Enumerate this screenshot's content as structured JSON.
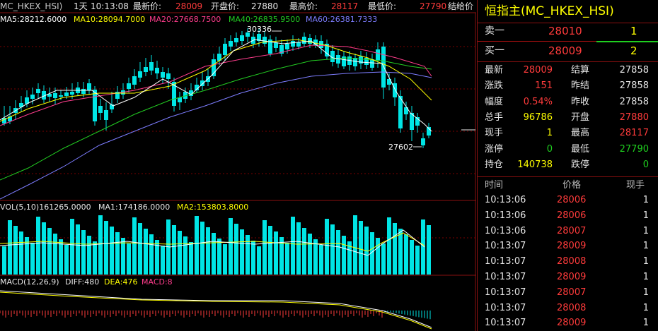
{
  "top_bar": {
    "symbol": "MC_HKEX_HSI)",
    "period": "1天",
    "time": "10:13:08",
    "latest_label": "最新价:",
    "latest_value": "28009",
    "open_label": "开盘价:",
    "open_value": "27880",
    "high_label": "最高价:",
    "high_value": "28117",
    "low_label": "最低价:",
    "low_value": "27790",
    "settle_label": "结给价"
  },
  "ma_legend": {
    "ma5": "MA5:28212.6000",
    "ma10": "MA10:28094.7000",
    "ma20": "MA20:27668.7500",
    "ma40": "MA40:26835.9500",
    "ma60": "MA60:26381.7333"
  },
  "annotations": {
    "high_marker": "30336",
    "low_marker": "27602"
  },
  "vol_legend": {
    "vol": "VOL(5,10)161265.0000",
    "ma1": "MA1:174186.0000",
    "ma2": "MA2:153803.8000"
  },
  "macd_legend": {
    "name": "MACD(12,26,9)",
    "diff": "DIFF:480",
    "dea": "DEA:476",
    "macd": "MACD:8"
  },
  "colors": {
    "up": "#ff3b3b",
    "down": "#00e5e5",
    "ma5": "#ffffff",
    "ma10": "#ffff00",
    "ma20": "#ff3d8c",
    "ma40": "#22cc22",
    "ma60": "#7d7dff",
    "panel_border": "#8a1010"
  },
  "panel": {
    "title": "恒指主(MC_HKEX_HSI)",
    "ask_label": "卖一",
    "ask_price": "28010",
    "ask_qty": "1",
    "bid_label": "买一",
    "bid_price": "28009",
    "bid_qty": "2",
    "stats": [
      {
        "l1": "最新",
        "v1": "28009",
        "c1": "red",
        "l2": "结算",
        "v2": "27858",
        "c2": "white"
      },
      {
        "l1": "涨跌",
        "v1": "151",
        "c1": "red",
        "l2": "昨结",
        "v2": "27858",
        "c2": "white"
      },
      {
        "l1": "幅度",
        "v1": "0.54%",
        "c1": "red",
        "l2": "昨收",
        "v2": "27858",
        "c2": "white"
      },
      {
        "l1": "总手",
        "v1": "96786",
        "c1": "yellow",
        "l2": "开盘",
        "v2": "27880",
        "c2": "red"
      },
      {
        "l1": "现手",
        "v1": "1",
        "c1": "yellow",
        "l2": "最高",
        "v2": "28117",
        "c2": "red"
      },
      {
        "l1": "涨停",
        "v1": "0",
        "c1": "green",
        "l2": "最低",
        "v2": "27790",
        "c2": "green"
      },
      {
        "l1": "持仓",
        "v1": "140738",
        "c1": "yellow",
        "l2": "跌停",
        "v2": "0",
        "c2": "green"
      }
    ],
    "ticks_header": {
      "time": "时间",
      "price": "价格",
      "qty": "现手"
    },
    "ticks": [
      {
        "time": "10:13:06",
        "price": "28006",
        "qty": "1"
      },
      {
        "time": "10:13:06",
        "price": "28006",
        "qty": "1"
      },
      {
        "time": "10:13:06",
        "price": "28007",
        "qty": "1"
      },
      {
        "time": "10:13:07",
        "price": "28009",
        "qty": "1"
      },
      {
        "time": "10:13:07",
        "price": "28008",
        "qty": "1"
      },
      {
        "time": "10:13:07",
        "price": "28009",
        "qty": "1"
      },
      {
        "time": "10:13:07",
        "price": "28007",
        "qty": "1"
      },
      {
        "time": "10:13:07",
        "price": "28008",
        "qty": "1"
      },
      {
        "time": "10:13:07",
        "price": "28009",
        "qty": "1"
      }
    ]
  }
}
